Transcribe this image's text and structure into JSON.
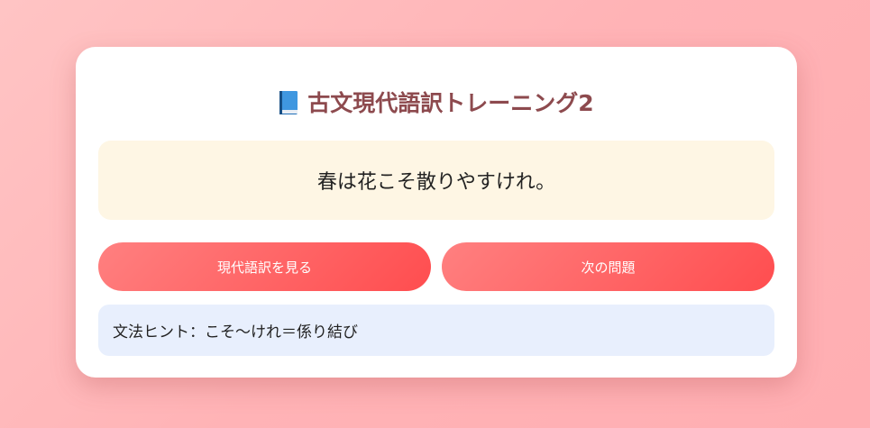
{
  "app": {
    "title_icon": "blue-book-icon",
    "title": "古文現代語訳トレーニング2"
  },
  "question": {
    "sentence": "春は花こそ散りやすけれ。"
  },
  "buttons": {
    "show_translation": "現代語訳を見る",
    "next_question": "次の問題"
  },
  "hint": {
    "text": "文法ヒント：こそ〜けれ＝係り結び"
  },
  "colors": {
    "background": "#ffb3b6",
    "title": "#8d4a4e",
    "sentence_box": "#fef6e4",
    "hint_box": "#e8effd",
    "button_start": "#ff8080",
    "button_end": "#ff4d4f"
  }
}
